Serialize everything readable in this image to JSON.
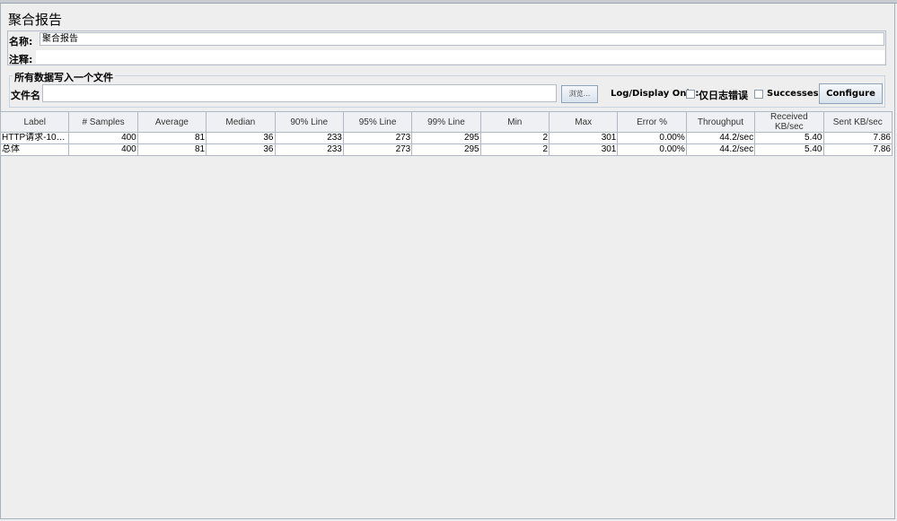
{
  "title": "聚合报告",
  "name_label": "名称:",
  "name_value": "聚合报告",
  "comment_label": "注释:",
  "comment_value": "",
  "file_group_title": "所有数据写入一个文件",
  "filename_label": "文件名",
  "filename_value": "",
  "browse_label": "浏览...",
  "log_display_label": "Log/Display Only:",
  "errors_only_label": "仅日志错误",
  "errors_only_checked": false,
  "successes_label": "Successes",
  "successes_checked": false,
  "configure_label": "Configure",
  "table": {
    "columns": [
      "Label",
      "# Samples",
      "Average",
      "Median",
      "90% Line",
      "95% Line",
      "99% Line",
      "Min",
      "Max",
      "Error %",
      "Throughput",
      "Received KB/sec",
      "Sent KB/sec"
    ],
    "rows": [
      [
        "HTTP请求-100...",
        "400",
        "81",
        "36",
        "233",
        "273",
        "295",
        "2",
        "301",
        "0.00%",
        "44.2/sec",
        "5.40",
        "7.86"
      ],
      [
        "总体",
        "400",
        "81",
        "36",
        "233",
        "273",
        "295",
        "2",
        "301",
        "0.00%",
        "44.2/sec",
        "5.40",
        "7.86"
      ]
    ]
  }
}
